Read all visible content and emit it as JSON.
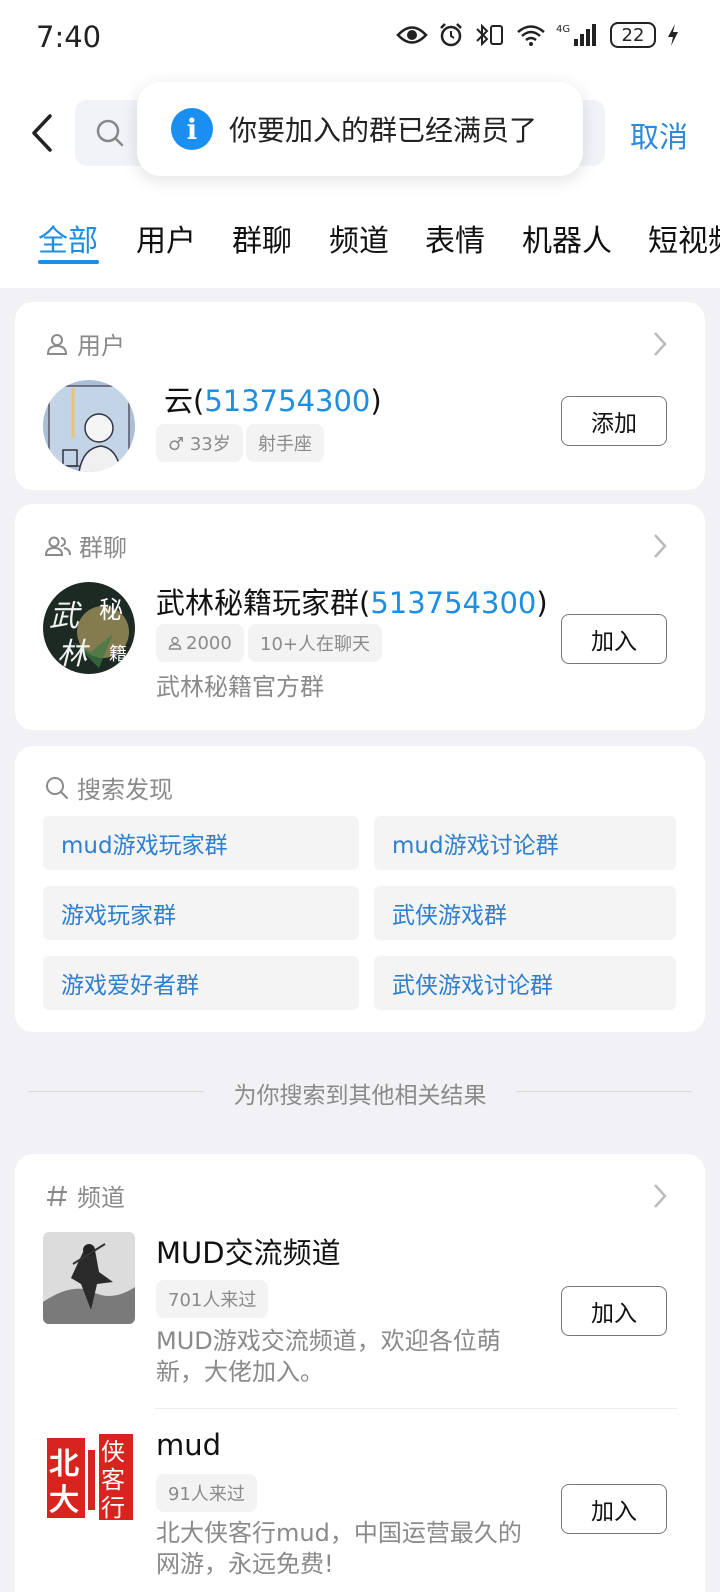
{
  "status_bar": {
    "time": "7:40",
    "battery": "22",
    "network": "4G"
  },
  "header": {
    "cancel_label": "取消",
    "toast_text": "你要加入的群已经满员了",
    "toast_icon": "info-icon"
  },
  "tabs": [
    "全部",
    "用户",
    "群聊",
    "频道",
    "表情",
    "机器人",
    "短视频"
  ],
  "user_section": {
    "title": "用户",
    "name": "云(",
    "number": "513754300",
    "close_paren": ")",
    "gender_age": "♂ 33岁",
    "zodiac": "射手座",
    "button": "添加"
  },
  "group_section": {
    "title": "群聊",
    "name": "武林秘籍玩家群(",
    "number": "513754300",
    "close_paren": ")",
    "members": "2000",
    "chatting": "10+人在聊天",
    "desc": "武林秘籍官方群",
    "button": "加入"
  },
  "discover": {
    "title": "搜索发现",
    "chips": [
      "mud游戏玩家群",
      "mud游戏讨论群",
      "游戏玩家群",
      "武侠游戏群",
      "游戏爱好者群",
      "武侠游戏讨论群"
    ]
  },
  "divider_text": "为你搜索到其他相关结果",
  "channel_section": {
    "title": "频道",
    "items": [
      {
        "name": "MUD交流频道",
        "visits": "701人来过",
        "desc_line1": "MUD游戏交流频道，欢迎各位萌",
        "desc_line2": "新，大佬加入。",
        "button": "加入"
      },
      {
        "name": "mud",
        "visits": "91人来过",
        "desc_line1": "北大侠客行mud，中国运营最久的",
        "desc_line2": "网游，永远免费!",
        "button": "加入"
      }
    ]
  }
}
